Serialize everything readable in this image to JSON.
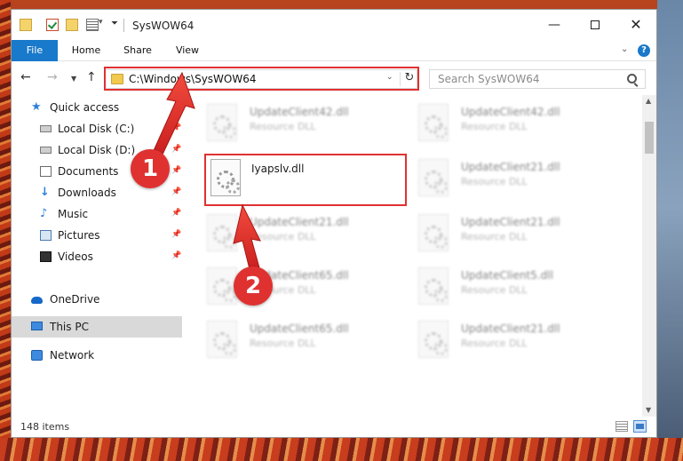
{
  "window": {
    "title": "SysWOW64",
    "min_label": "—",
    "close_label": "✕"
  },
  "ribbon": {
    "tabs": [
      "File",
      "Home",
      "Share",
      "View"
    ],
    "help_label": "?"
  },
  "address": {
    "path": "C:\\Windows\\SysWOW64",
    "search_placeholder": "Search SysWOW64"
  },
  "sidebar": {
    "items": [
      {
        "label": "Quick access",
        "icon": "star-icon",
        "pinned": false
      },
      {
        "label": "Local Disk (C:)",
        "icon": "drive-icon",
        "pinned": true
      },
      {
        "label": "Local Disk (D:)",
        "icon": "drive-icon",
        "pinned": true
      },
      {
        "label": "Documents",
        "icon": "document-icon",
        "pinned": true
      },
      {
        "label": "Downloads",
        "icon": "download-icon",
        "pinned": true
      },
      {
        "label": "Music",
        "icon": "music-icon",
        "pinned": true
      },
      {
        "label": "Pictures",
        "icon": "picture-icon",
        "pinned": true
      },
      {
        "label": "Videos",
        "icon": "video-icon",
        "pinned": true
      },
      {
        "label": "OneDrive",
        "icon": "cloud-icon",
        "pinned": false
      },
      {
        "label": "This PC",
        "icon": "computer-icon",
        "pinned": false,
        "selected": true
      },
      {
        "label": "Network",
        "icon": "network-icon",
        "pinned": false
      }
    ]
  },
  "files": [
    {
      "name": "UpdateClient42.dll",
      "type": "Resource DLL"
    },
    {
      "name": "UpdateClient42.dll",
      "type": "Resource DLL"
    },
    {
      "name": "Iyapslv.dll",
      "type": ""
    },
    {
      "name": "UpdateClient21.dll",
      "type": "Resource DLL"
    },
    {
      "name": "UpdateClient21.dll",
      "type": "Resource DLL"
    },
    {
      "name": "UpdateClient21.dll",
      "type": "Resource DLL"
    },
    {
      "name": "UpdateClient65.dll",
      "type": "Resource DLL"
    },
    {
      "name": "UpdateClient5.dll",
      "type": "Resource DLL"
    },
    {
      "name": "UpdateClient65.dll",
      "type": "Resource DLL"
    },
    {
      "name": "UpdateClient21.dll",
      "type": "Resource DLL"
    }
  ],
  "status": {
    "item_count": "148 items"
  },
  "annotations": {
    "callout_1": "1",
    "callout_2": "2",
    "highlight_color": "#e03131"
  }
}
